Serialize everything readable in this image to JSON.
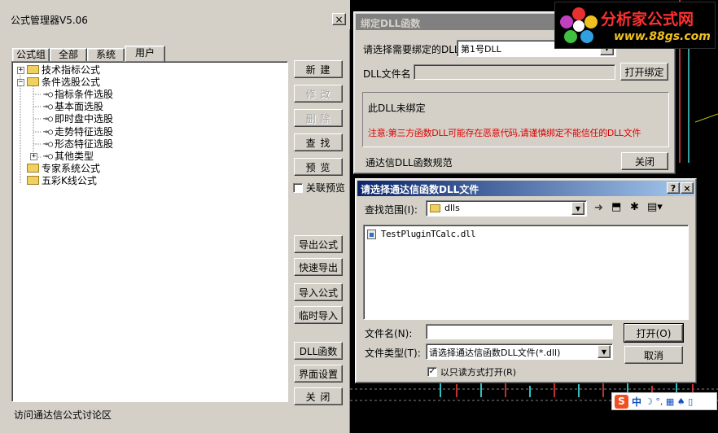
{
  "main_window": {
    "title": "公式管理器V5.06",
    "close": "×",
    "tabs": [
      "公式组",
      "全部",
      "系统",
      "用户"
    ],
    "tree": [
      {
        "label": "技术指标公式",
        "type": "folder",
        "expander": "+"
      },
      {
        "label": "条件选股公式",
        "type": "folder",
        "expander": "−"
      },
      {
        "label": "指标条件选股",
        "type": "key"
      },
      {
        "label": "基本面选股",
        "type": "key"
      },
      {
        "label": "即时盘中选股",
        "type": "key"
      },
      {
        "label": "走势特征选股",
        "type": "key"
      },
      {
        "label": "形态特征选股",
        "type": "key"
      },
      {
        "label": "其他类型",
        "type": "key",
        "expander": "+"
      },
      {
        "label": "专家系统公式",
        "type": "folder"
      },
      {
        "label": "五彩K线公式",
        "type": "folder"
      }
    ],
    "buttons": {
      "new": "新 建",
      "modify": "修 改",
      "delete": "删 除",
      "find": "查 找",
      "preview": "预 览",
      "export": "导出公式",
      "quick_export": "快速导出",
      "import": "导入公式",
      "temp_import": "临时导入",
      "dll": "DLL函数",
      "ui_settings": "界面设置",
      "close": "关 闭"
    },
    "linked_preview": "关联预览",
    "status": "访问通达信公式讨论区"
  },
  "dll_window": {
    "title": "绑定DLL函数",
    "select_label": "请选择需要绑定的DLL",
    "select_value": "第1号DLL",
    "filename_label": "DLL文件名",
    "open_bind": "打开绑定",
    "not_bound": "此DLL未绑定",
    "warning": "注意:第三方函数DLL可能存在恶意代码,请谨慎绑定不能信任的DLL文件",
    "spec": "通达信DLL函数规范",
    "close": "关闭"
  },
  "file_dialog": {
    "title": "请选择通达信函数DLL文件",
    "help": "?",
    "close": "×",
    "lookin_label": "查找范围(I):",
    "lookin_value": "dlls",
    "files": [
      "TestPluginTCalc.dll"
    ],
    "filename_label": "文件名(N):",
    "filename_value": "",
    "filetype_label": "文件类型(T):",
    "filetype_value": "请选择通达信函数DLL文件(*.dll)",
    "open": "打开(O)",
    "cancel": "取消",
    "readonly_label": "以只读方式打开(R)",
    "readonly_checked": "✓"
  },
  "watermark": {
    "brand": "分析家公式网",
    "url": "www.88gs.com"
  },
  "ime": {
    "s": "S",
    "zh": "中",
    "icons": "☽ °, ▦ ♠ ▯"
  }
}
